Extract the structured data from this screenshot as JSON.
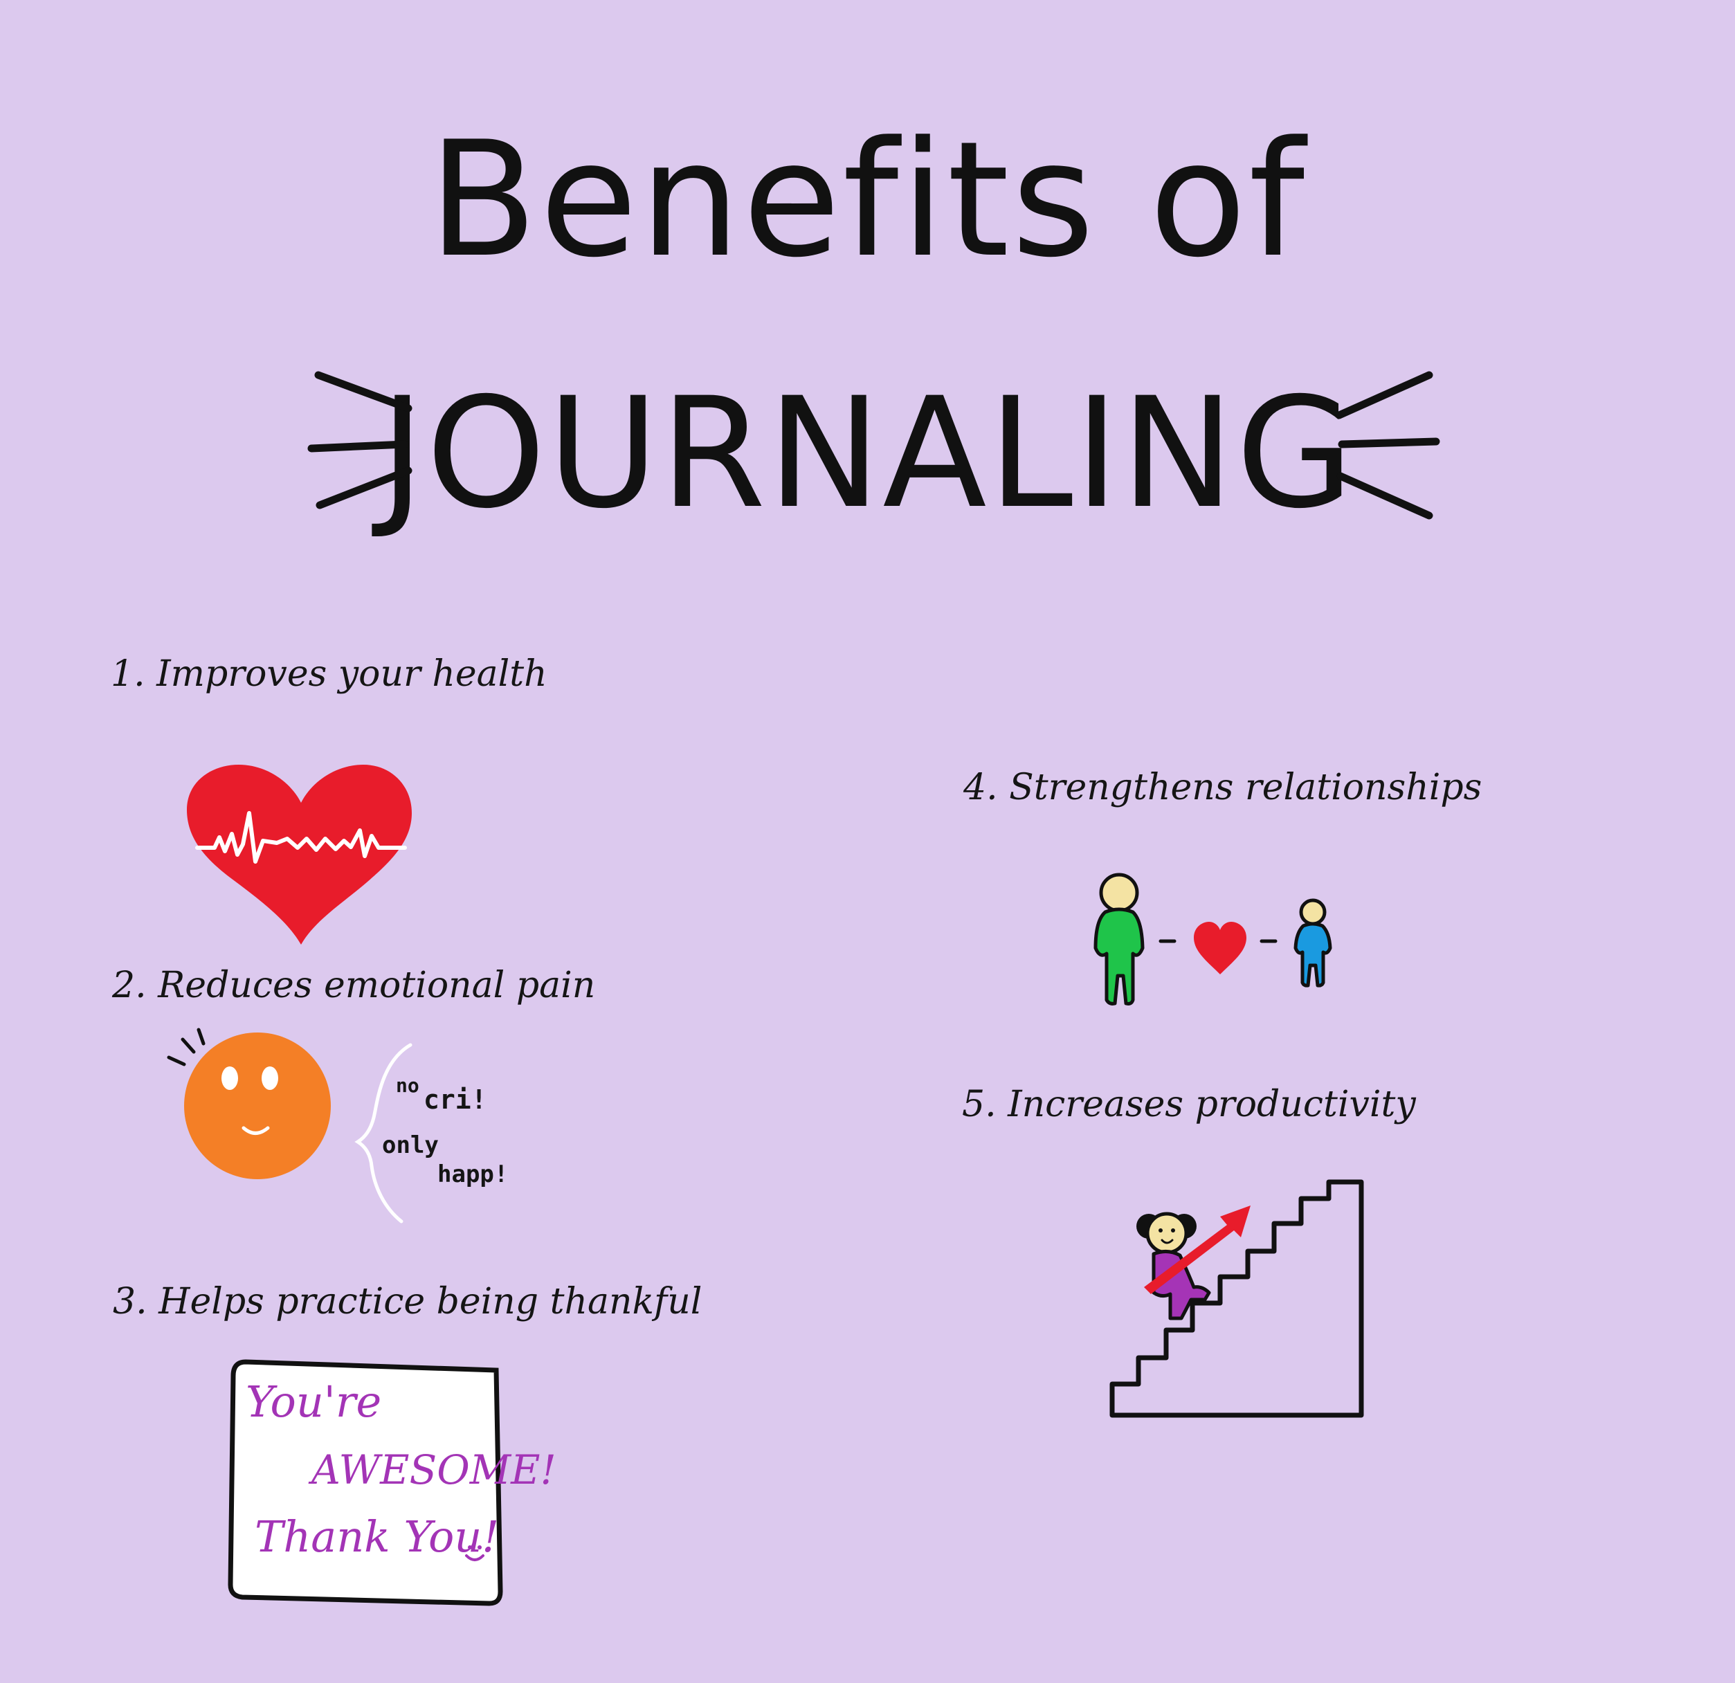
{
  "title": {
    "line1": "Benefits of",
    "line2": "JOURNALING"
  },
  "benefits": [
    {
      "label": "1. Improves your health",
      "icon": "heartbeat-heart-icon"
    },
    {
      "label": "2. Reduces emotional pain",
      "icon": "smiley-face-icon"
    },
    {
      "label": "3. Helps practice being thankful",
      "icon": "thank-you-note-icon"
    },
    {
      "label": "4. Strengthens relationships",
      "icon": "two-people-heart-icon"
    },
    {
      "label": "5. Increases productivity",
      "icon": "stairs-climb-icon"
    }
  ],
  "speech": {
    "no": "no",
    "cri": "cri!",
    "only": "only",
    "happ": "happ!"
  },
  "note": {
    "line1": "You're",
    "line2": "AWESOME!",
    "line3": "Thank You!"
  },
  "colors": {
    "background": "#dcc9ee",
    "heart": "#e81c2b",
    "face": "#f47f26",
    "person_green": "#1fc44a",
    "person_blue": "#1a9ae0",
    "girl_purple": "#a534b6",
    "note_text": "#a334b6"
  }
}
